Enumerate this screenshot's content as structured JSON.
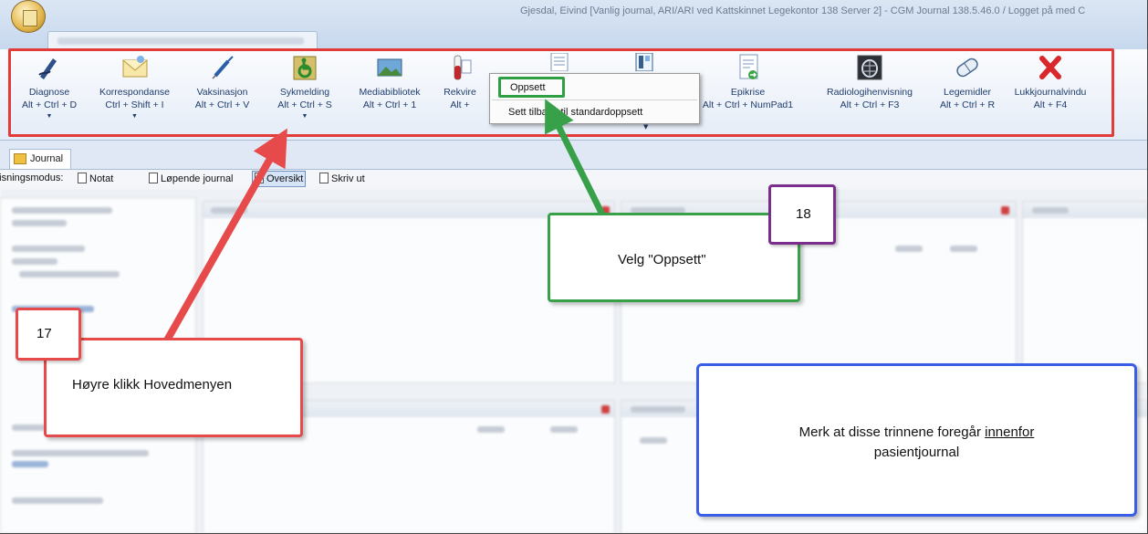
{
  "window": {
    "title": "Gjesdal, Eivind [Vanlig journal, ARI/ARI ved Kattskinnet Legekontor 138 Server 2] - CGM Journal 138.5.46.0 / Logget på med  C"
  },
  "ribbon": {
    "buttons": [
      {
        "label": "Diagnose",
        "shortcut": "Alt + Ctrl + D",
        "icon": "diagnose-pen-icon",
        "dropdown": true
      },
      {
        "label": "Korrespondanse",
        "shortcut": "Ctrl + Shift + I",
        "icon": "envelope-icon",
        "dropdown": true
      },
      {
        "label": "Vaksinasjon",
        "shortcut": "Alt + Ctrl + V",
        "icon": "syringe-icon",
        "dropdown": false
      },
      {
        "label": "Sykmelding",
        "shortcut": "Alt + Ctrl + S",
        "icon": "wheelchair-icon",
        "dropdown": true
      },
      {
        "label": "Mediabibliotek",
        "shortcut": "Alt + Ctrl + 1",
        "icon": "image-icon",
        "dropdown": false
      },
      {
        "label": "Rekvire",
        "shortcut": "Alt +",
        "icon": "test-tube-icon",
        "dropdown": false
      },
      {
        "label": "Epikrise",
        "shortcut": "Alt + Ctrl + NumPad1",
        "icon": "epikrise-document-icon",
        "dropdown": false
      },
      {
        "label": "Radiologihenvisning",
        "shortcut": "Alt + Ctrl + F3",
        "icon": "xray-icon",
        "dropdown": false
      },
      {
        "label": "Legemidler",
        "shortcut": "Alt + Ctrl + R",
        "icon": "pill-icon",
        "dropdown": false
      },
      {
        "label": "Lukkjournalvindu",
        "shortcut": "Alt + F4",
        "icon": "close-red-x-icon",
        "dropdown": false
      }
    ]
  },
  "context_menu": {
    "items": [
      "Oppsett",
      "Sett tilbake til standardoppsett"
    ]
  },
  "tabs": {
    "journal": "Journal"
  },
  "view_mode": {
    "label": "Visningsmodus:",
    "options": [
      "Notat",
      "Løpende journal",
      "Oversikt",
      "Skriv ut"
    ],
    "active": "Oversikt"
  },
  "annotations": {
    "step17_number": "17",
    "step17_text": "Høyre klikk Hovedmenyen",
    "step18_number": "18",
    "step18_text": "Velg \"Oppsett\"",
    "note_line1": "Merk at disse trinnene foregår ",
    "note_underlined": "innenfor",
    "note_line2": "pasientjournal"
  },
  "colors": {
    "step17_accent": "#e33a3a",
    "step18_accent": "#37a049",
    "step18_number_border": "#7a2d8c",
    "note_border": "#3b5ee6"
  }
}
